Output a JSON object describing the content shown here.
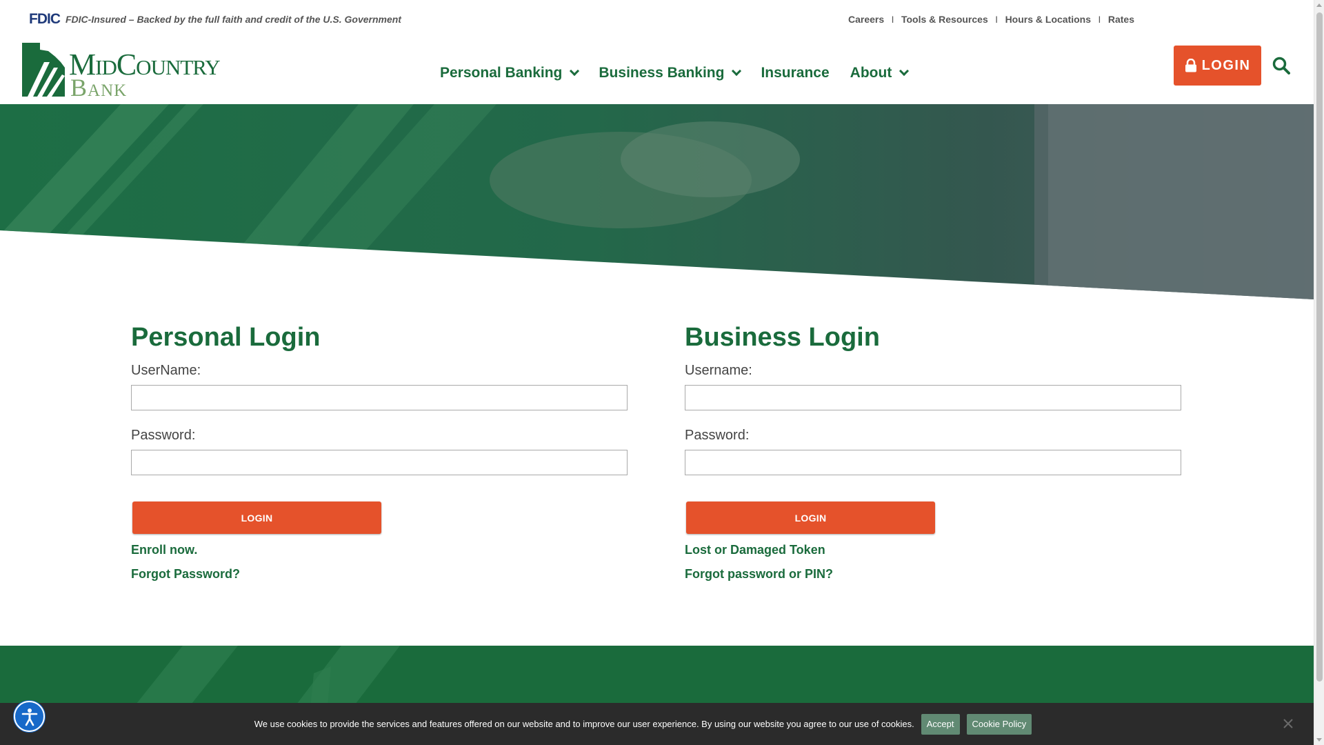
{
  "colors": {
    "brand_green": "#1a6b3c",
    "accent_orange": "#e5522b",
    "cookie_bg": "#2b2b2b",
    "a11y_blue": "#1769c9"
  },
  "topbar": {
    "fdic_logo": "FDIC",
    "fdic_text": "FDIC-Insured – Backed by the full faith and credit of the U.S. Government",
    "util_links": [
      "Careers",
      "Tools & Resources",
      "Hours & Locations",
      "Rates"
    ]
  },
  "logo": {
    "word_top": "MidCountry",
    "word_bottom": "Bank"
  },
  "nav": {
    "items": [
      {
        "label": "Personal Banking",
        "has_dropdown": true
      },
      {
        "label": "Business Banking",
        "has_dropdown": true
      },
      {
        "label": "Insurance",
        "has_dropdown": false
      },
      {
        "label": "About",
        "has_dropdown": true
      }
    ],
    "login_label": "LOGIN",
    "login_icon": "lock-icon",
    "search_icon": "search-icon"
  },
  "personal": {
    "title": "Personal Login",
    "username_label": "UserName:",
    "username_value": "",
    "password_label": "Password:",
    "password_value": "",
    "submit_label": "LOGIN",
    "link1": "Enroll now.",
    "link2": "Forgot Password?"
  },
  "business": {
    "title": "Business Login",
    "username_label": "Username:",
    "username_value": "",
    "password_label": "Password:",
    "password_value": "",
    "submit_label": "LOGIN",
    "link1": "Lost or Damaged Token",
    "link2": "Forgot password or PIN?"
  },
  "cookie": {
    "text": "We use cookies to provide the services and features offered on our website and to improve our user experience. By using our website you agree to our use of cookies.",
    "accept_label": "Accept",
    "policy_label": "Cookie Policy",
    "close_icon": "close-icon"
  },
  "accessibility": {
    "icon": "accessibility-icon"
  }
}
